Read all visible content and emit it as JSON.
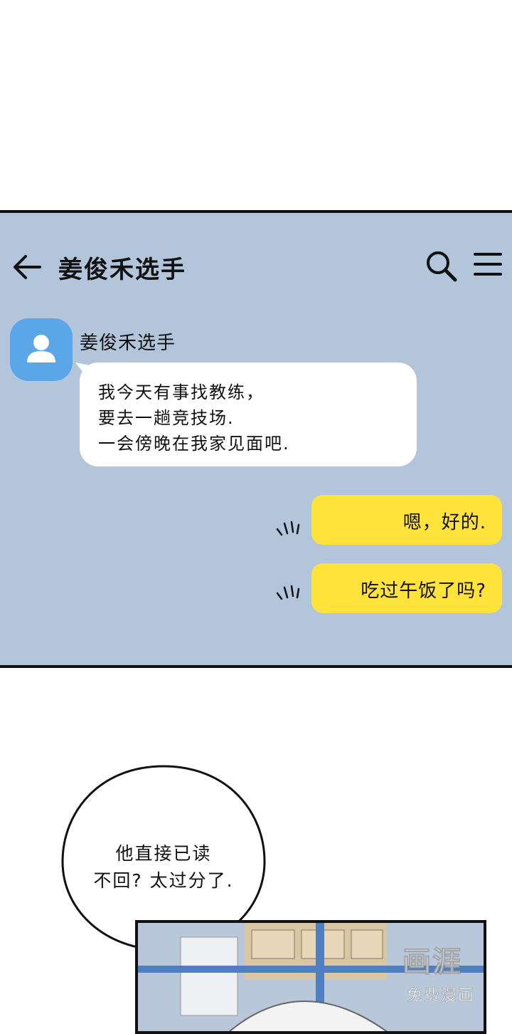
{
  "header": {
    "title": "姜俊禾选手",
    "back_icon": "arrow-left-icon",
    "search_icon": "search-icon",
    "menu_icon": "hamburger-menu-icon"
  },
  "chat": {
    "incoming": {
      "sender": "姜俊禾选手",
      "avatar_icon": "person-avatar-icon",
      "lines": [
        "我今天有事找教练，",
        "要去一趟竞技场.",
        "一会傍晚在我家见面吧."
      ]
    },
    "outgoing": [
      {
        "text": "嗯，好的."
      },
      {
        "text": "吃过午饭了吗?"
      }
    ]
  },
  "thought_bubble": {
    "lines": [
      "他直接已读",
      "不回? 太过分了."
    ]
  },
  "watermark": {
    "logo": "画涯",
    "subtitle": "免费漫画"
  },
  "colors": {
    "phone_bg": "#b3c5da",
    "outgoing_bubble": "#ffe33a",
    "incoming_bubble": "#ffffff",
    "avatar": "#5aa6e6"
  }
}
